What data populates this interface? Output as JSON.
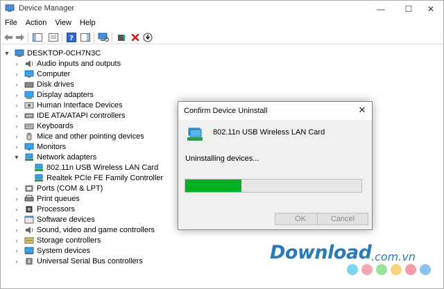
{
  "window": {
    "title": "Device Manager",
    "controls": {
      "minimize": "—",
      "maximize": "☐",
      "close": "✕"
    }
  },
  "menu": [
    "File",
    "Action",
    "View",
    "Help"
  ],
  "tree": {
    "root": "DESKTOP-0CH7N3C",
    "items": [
      {
        "label": "Audio inputs and outputs",
        "icon": "speaker-icon"
      },
      {
        "label": "Computer",
        "icon": "monitor-icon"
      },
      {
        "label": "Disk drives",
        "icon": "disk-icon"
      },
      {
        "label": "Display adapters",
        "icon": "display-adapter-icon"
      },
      {
        "label": "Human Interface Devices",
        "icon": "hid-icon"
      },
      {
        "label": "IDE ATA/ATAPI controllers",
        "icon": "ide-icon"
      },
      {
        "label": "Keyboards",
        "icon": "keyboard-icon"
      },
      {
        "label": "Mice and other pointing devices",
        "icon": "mouse-icon"
      },
      {
        "label": "Monitors",
        "icon": "monitor-icon"
      },
      {
        "label": "Network adapters",
        "icon": "network-icon",
        "expanded": true
      },
      {
        "label": "802.11n USB Wireless LAN Card",
        "icon": "network-icon",
        "child": true
      },
      {
        "label": "Realtek PCIe FE Family Controller",
        "icon": "network-icon",
        "child": true
      },
      {
        "label": "Ports (COM & LPT)",
        "icon": "port-icon"
      },
      {
        "label": "Print queues",
        "icon": "printer-icon"
      },
      {
        "label": "Processors",
        "icon": "processor-icon"
      },
      {
        "label": "Software devices",
        "icon": "software-icon"
      },
      {
        "label": "Sound, video and game controllers",
        "icon": "speaker-icon"
      },
      {
        "label": "Storage controllers",
        "icon": "storage-icon"
      },
      {
        "label": "System devices",
        "icon": "system-icon"
      },
      {
        "label": "Universal Serial Bus controllers",
        "icon": "usb-icon"
      }
    ]
  },
  "dialog": {
    "title": "Confirm Device Uninstall",
    "device_name": "802.11n USB Wireless LAN Card",
    "status": "Uninstalling devices...",
    "progress": 0.32,
    "ok_label": "OK",
    "cancel_label": "Cancel",
    "close": "✕"
  },
  "watermark": {
    "brand": "Download",
    "suffix": ".com.vn",
    "dot_colors": [
      "#7fd3f0",
      "#f6a5b4",
      "#9be09c",
      "#f9d27c",
      "#f49aa8",
      "#8fc3ef"
    ]
  },
  "colors": {
    "progress": "#06b025",
    "accent": "#2a7ab8"
  }
}
